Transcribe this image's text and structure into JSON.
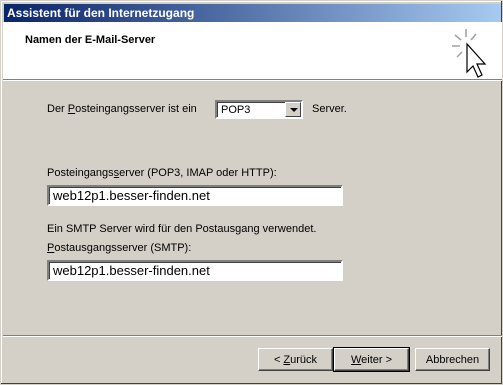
{
  "window": {
    "title": "Assistent für den Internetzugang"
  },
  "header": {
    "title": "Namen der E-Mail-Server",
    "icon": "wizard-cursor-icon"
  },
  "form": {
    "incoming_type_prefix": "Der ",
    "incoming_type_prefix_u": "P",
    "incoming_type_prefix_rest": "osteingangsserver ist ein",
    "incoming_type_value": "POP3",
    "incoming_type_suffix": "Server.",
    "incoming_label_a": "Posteingangs",
    "incoming_label_u": "s",
    "incoming_label_b": "erver (POP3, IMAP oder HTTP):",
    "incoming_value": "web12p1.besser-finden.net",
    "smtp_note": "Ein SMTP Server wird für den Postausgang verwendet.",
    "outgoing_label_u": "P",
    "outgoing_label_rest": "ostausgangsserver (SMTP):",
    "outgoing_value": "web12p1.besser-finden.net"
  },
  "buttons": {
    "back_pre": "< ",
    "back_u": "Z",
    "back_rest": "urück",
    "next_u": "W",
    "next_rest": "eiter >",
    "cancel": "Abbrechen"
  }
}
